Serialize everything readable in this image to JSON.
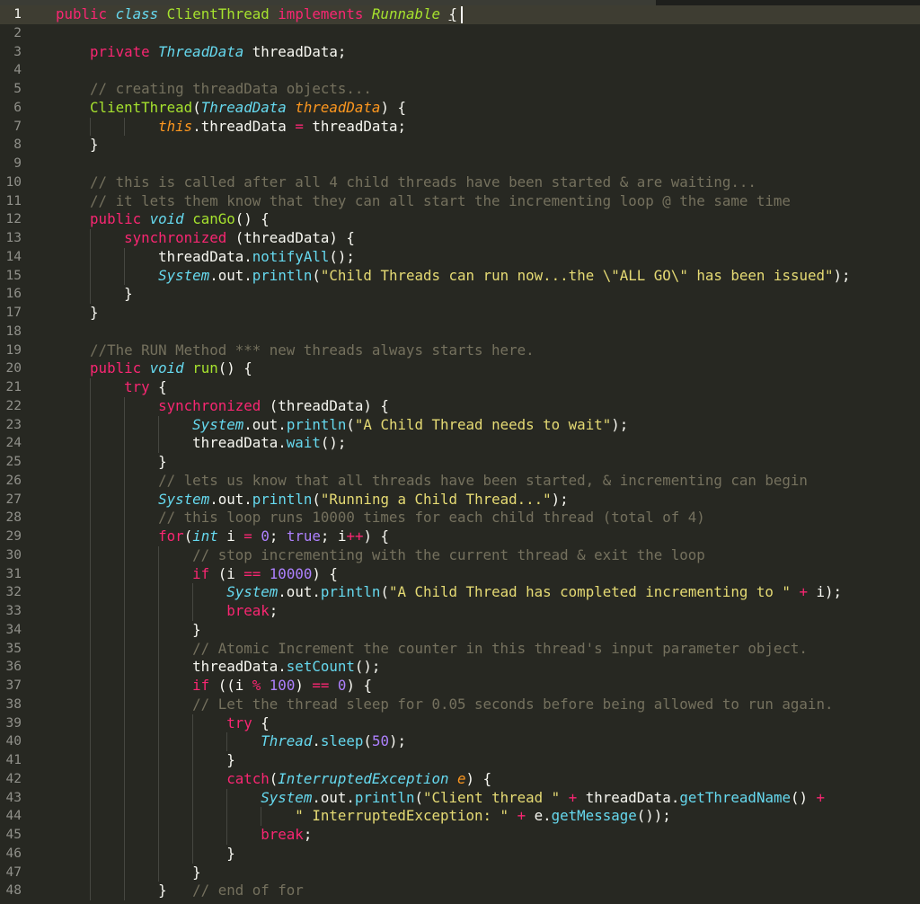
{
  "editor": {
    "theme_colors": {
      "background": "#272822",
      "keyword": "#f92672",
      "function": "#a6e22e",
      "string": "#e6db74",
      "number": "#ae81ff",
      "comment": "#75715e",
      "storage": "#66d9ef",
      "parameter": "#fd971f",
      "plain": "#f8f8f2"
    },
    "active_line": 1,
    "lines": [
      [
        [
          "kw",
          "public "
        ],
        [
          "st",
          "class "
        ],
        [
          "cl",
          "ClientThread "
        ],
        [
          "kw",
          "implements "
        ],
        [
          "ih",
          "Runnable"
        ],
        [
          "pl",
          " "
        ],
        [
          "ul",
          "{"
        ]
      ],
      [],
      [
        [
          "pl",
          "    "
        ],
        [
          "kw",
          "private "
        ],
        [
          "ty",
          "ThreadData"
        ],
        [
          "pl",
          " threadData;"
        ]
      ],
      [],
      [
        [
          "pl",
          "    "
        ],
        [
          "cm",
          "// creating threadData objects..."
        ]
      ],
      [
        [
          "pl",
          "    "
        ],
        [
          "fn",
          "ClientThread"
        ],
        [
          "pl",
          "("
        ],
        [
          "ty",
          "ThreadData "
        ],
        [
          "pa",
          "threadData"
        ],
        [
          "pl",
          ") {"
        ]
      ],
      [
        [
          "pl",
          "            "
        ],
        [
          "pa",
          "this"
        ],
        [
          "pl",
          ".threadData "
        ],
        [
          "kw",
          "="
        ],
        [
          "pl",
          " threadData;"
        ]
      ],
      [
        [
          "pl",
          "    }"
        ]
      ],
      [],
      [
        [
          "pl",
          "    "
        ],
        [
          "cm",
          "// this is called after all 4 child threads have been started & are waiting..."
        ]
      ],
      [
        [
          "pl",
          "    "
        ],
        [
          "cm",
          "// it lets them know that they can all start the incrementing loop @ the same time"
        ]
      ],
      [
        [
          "pl",
          "    "
        ],
        [
          "kw",
          "public "
        ],
        [
          "st",
          "void "
        ],
        [
          "fn",
          "canGo"
        ],
        [
          "pl",
          "() {"
        ]
      ],
      [
        [
          "pl",
          "        "
        ],
        [
          "kw",
          "synchronized"
        ],
        [
          "pl",
          " (threadData) {"
        ]
      ],
      [
        [
          "pl",
          "            threadData."
        ],
        [
          "mth",
          "notifyAll"
        ],
        [
          "pl",
          "();"
        ]
      ],
      [
        [
          "pl",
          "            "
        ],
        [
          "st",
          "System"
        ],
        [
          "pl",
          ".out."
        ],
        [
          "mth",
          "println"
        ],
        [
          "pl",
          "("
        ],
        [
          "str",
          "\"Child Threads can run now...the \\\"ALL GO\\\" has been issued\""
        ],
        [
          "pl",
          ");"
        ]
      ],
      [
        [
          "pl",
          "        }"
        ]
      ],
      [
        [
          "pl",
          "    }"
        ]
      ],
      [],
      [
        [
          "pl",
          "    "
        ],
        [
          "cm",
          "//The RUN Method *** new threads always starts here."
        ]
      ],
      [
        [
          "pl",
          "    "
        ],
        [
          "kw",
          "public "
        ],
        [
          "st",
          "void "
        ],
        [
          "fn",
          "run"
        ],
        [
          "pl",
          "() {"
        ]
      ],
      [
        [
          "pl",
          "        "
        ],
        [
          "kw",
          "try"
        ],
        [
          "pl",
          " {"
        ]
      ],
      [
        [
          "pl",
          "            "
        ],
        [
          "kw",
          "synchronized"
        ],
        [
          "pl",
          " (threadData) {"
        ]
      ],
      [
        [
          "pl",
          "                "
        ],
        [
          "st",
          "System"
        ],
        [
          "pl",
          ".out."
        ],
        [
          "mth",
          "println"
        ],
        [
          "pl",
          "("
        ],
        [
          "str",
          "\"A Child Thread needs to wait\""
        ],
        [
          "pl",
          ");"
        ]
      ],
      [
        [
          "pl",
          "                threadData."
        ],
        [
          "mth",
          "wait"
        ],
        [
          "pl",
          "();"
        ]
      ],
      [
        [
          "pl",
          "            }"
        ]
      ],
      [
        [
          "pl",
          "            "
        ],
        [
          "cm",
          "// lets us know that all threads have been started, & incrementing can begin"
        ]
      ],
      [
        [
          "pl",
          "            "
        ],
        [
          "st",
          "System"
        ],
        [
          "pl",
          ".out."
        ],
        [
          "mth",
          "println"
        ],
        [
          "pl",
          "("
        ],
        [
          "str",
          "\"Running a Child Thread...\""
        ],
        [
          "pl",
          ");"
        ]
      ],
      [
        [
          "pl",
          "            "
        ],
        [
          "cm",
          "// this loop runs 10000 times for each child thread (total of 4)"
        ]
      ],
      [
        [
          "pl",
          "            "
        ],
        [
          "kw",
          "for"
        ],
        [
          "pl",
          "("
        ],
        [
          "st",
          "int"
        ],
        [
          "pl",
          " i "
        ],
        [
          "kw",
          "="
        ],
        [
          "pl",
          " "
        ],
        [
          "num",
          "0"
        ],
        [
          "pl",
          "; "
        ],
        [
          "con",
          "true"
        ],
        [
          "pl",
          "; i"
        ],
        [
          "kw",
          "++"
        ],
        [
          "pl",
          ") {"
        ]
      ],
      [
        [
          "pl",
          "                "
        ],
        [
          "cm",
          "// stop incrementing with the current thread & exit the loop"
        ]
      ],
      [
        [
          "pl",
          "                "
        ],
        [
          "kw",
          "if"
        ],
        [
          "pl",
          " (i "
        ],
        [
          "kw",
          "=="
        ],
        [
          "pl",
          " "
        ],
        [
          "num",
          "10000"
        ],
        [
          "pl",
          ") {"
        ]
      ],
      [
        [
          "pl",
          "                    "
        ],
        [
          "st",
          "System"
        ],
        [
          "pl",
          ".out."
        ],
        [
          "mth",
          "println"
        ],
        [
          "pl",
          "("
        ],
        [
          "str",
          "\"A Child Thread has completed incrementing to \""
        ],
        [
          "pl",
          " "
        ],
        [
          "kw",
          "+"
        ],
        [
          "pl",
          " i);"
        ]
      ],
      [
        [
          "pl",
          "                    "
        ],
        [
          "kw",
          "break"
        ],
        [
          "pl",
          ";"
        ]
      ],
      [
        [
          "pl",
          "                }"
        ]
      ],
      [
        [
          "pl",
          "                "
        ],
        [
          "cm",
          "// Atomic Increment the counter in this thread's input parameter object."
        ]
      ],
      [
        [
          "pl",
          "                threadData."
        ],
        [
          "mth",
          "setCount"
        ],
        [
          "pl",
          "();"
        ]
      ],
      [
        [
          "pl",
          "                "
        ],
        [
          "kw",
          "if"
        ],
        [
          "pl",
          " ((i "
        ],
        [
          "kw",
          "%"
        ],
        [
          "pl",
          " "
        ],
        [
          "num",
          "100"
        ],
        [
          "pl",
          ") "
        ],
        [
          "kw",
          "=="
        ],
        [
          "pl",
          " "
        ],
        [
          "num",
          "0"
        ],
        [
          "pl",
          ") {"
        ]
      ],
      [
        [
          "pl",
          "                "
        ],
        [
          "cm",
          "// Let the thread sleep for 0.05 seconds before being allowed to run again."
        ]
      ],
      [
        [
          "pl",
          "                    "
        ],
        [
          "kw",
          "try"
        ],
        [
          "pl",
          " {"
        ]
      ],
      [
        [
          "pl",
          "                        "
        ],
        [
          "st",
          "Thread"
        ],
        [
          "pl",
          "."
        ],
        [
          "mth",
          "sleep"
        ],
        [
          "pl",
          "("
        ],
        [
          "num",
          "50"
        ],
        [
          "pl",
          ");"
        ]
      ],
      [
        [
          "pl",
          "                    }"
        ]
      ],
      [
        [
          "pl",
          "                    "
        ],
        [
          "kw",
          "catch"
        ],
        [
          "pl",
          "("
        ],
        [
          "ty",
          "InterruptedException "
        ],
        [
          "pa",
          "e"
        ],
        [
          "pl",
          ") {"
        ]
      ],
      [
        [
          "pl",
          "                        "
        ],
        [
          "st",
          "System"
        ],
        [
          "pl",
          ".out."
        ],
        [
          "mth",
          "println"
        ],
        [
          "pl",
          "("
        ],
        [
          "str",
          "\"Client thread \""
        ],
        [
          "pl",
          " "
        ],
        [
          "kw",
          "+"
        ],
        [
          "pl",
          " threadData."
        ],
        [
          "mth",
          "getThreadName"
        ],
        [
          "pl",
          "() "
        ],
        [
          "kw",
          "+"
        ]
      ],
      [
        [
          "pl",
          "                            "
        ],
        [
          "str",
          "\" InterruptedException: \""
        ],
        [
          "pl",
          " "
        ],
        [
          "kw",
          "+"
        ],
        [
          "pl",
          " e."
        ],
        [
          "mth",
          "getMessage"
        ],
        [
          "pl",
          "());"
        ]
      ],
      [
        [
          "pl",
          "                        "
        ],
        [
          "kw",
          "break"
        ],
        [
          "pl",
          ";"
        ]
      ],
      [
        [
          "pl",
          "                    }"
        ]
      ],
      [
        [
          "pl",
          "                }"
        ]
      ],
      [
        [
          "pl",
          "            }   "
        ],
        [
          "cm",
          "// end of for"
        ]
      ]
    ]
  }
}
